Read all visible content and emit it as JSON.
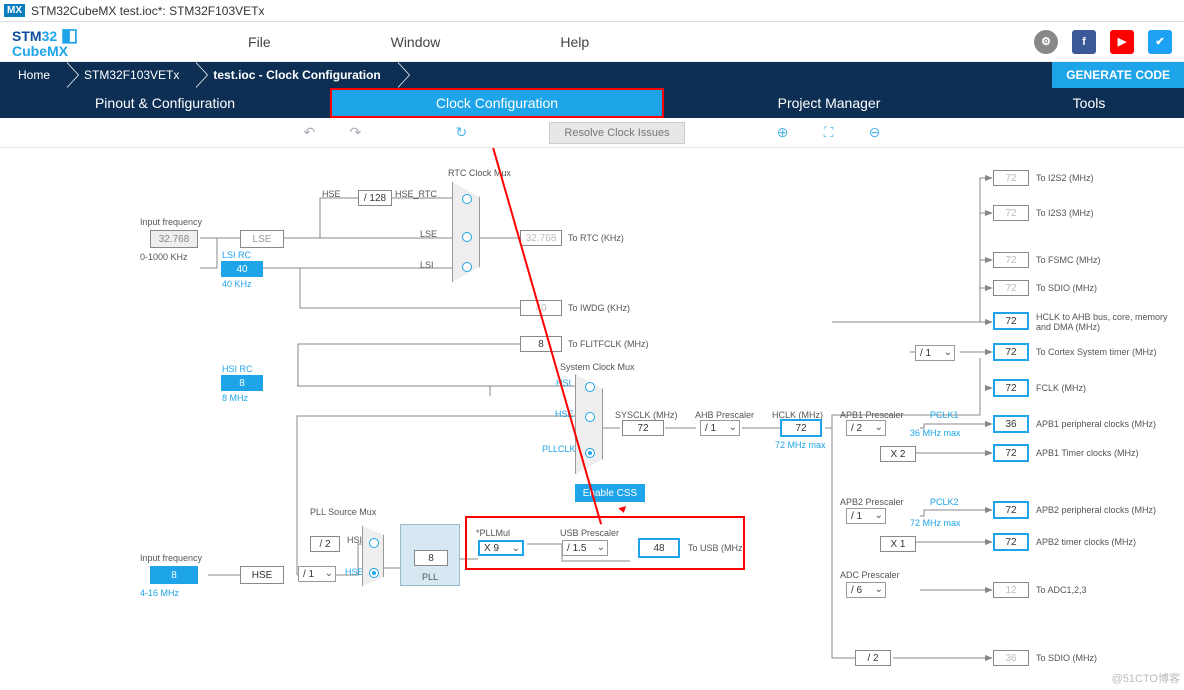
{
  "title_bar": {
    "app": "STM32CubeMX",
    "file": "test.ioc*:",
    "chip": "STM32F103VETx"
  },
  "menu": {
    "file": "File",
    "window": "Window",
    "help": "Help"
  },
  "breadcrumbs": {
    "home": "Home",
    "chip": "STM32F103VETx",
    "file": "test.ioc - Clock Configuration"
  },
  "generate": "GENERATE CODE",
  "tabs": {
    "pinout": "Pinout & Configuration",
    "clock": "Clock Configuration",
    "project": "Project Manager",
    "tools": "Tools"
  },
  "toolbar": {
    "resolve": "Resolve Clock Issues"
  },
  "clock": {
    "lse_freq": "32.768",
    "lse_range": "0-1000 KHz",
    "lse_label": "Input frequency",
    "lse": "LSE",
    "lsi_label": "LSI RC",
    "lsi": "40",
    "lsi_sub": "40 KHz",
    "hsi_label": "HSI RC",
    "hsi": "8",
    "hsi_sub": "8 MHz",
    "hse_freq": "8",
    "hse_range": "4-16 MHz",
    "hse_label": "Input frequency",
    "hse": "HSE",
    "hse_div128": "/ 128",
    "hse_rtc": "HSE_RTC",
    "hse_lbl": "HSE",
    "lse_lbl": "LSE",
    "lsi_lbl": "LSI",
    "rtc_mux": "RTC Clock Mux",
    "to_rtc": "To RTC (KHz)",
    "rtc_val": "32.768",
    "iwdg_val": "40",
    "to_iwdg": "To IWDG (KHz)",
    "flit_val": "8",
    "to_flit": "To FLITFCLK (MHz)",
    "sys_mux": "System Clock Mux",
    "hsi_lbl2": "HSI",
    "hse_lbl2": "HSE",
    "pllclk_lbl": "PLLCLK",
    "enable_css": "Enable CSS",
    "pll_src": "PLL Source Mux",
    "pll_div2": "/ 2",
    "pll_hsi": "HSI",
    "pll_hse": "HSE",
    "pll_div1": "/ 1",
    "pllmul_lbl": "*PLLMul",
    "pllmul": "X 9",
    "pll_val": "8",
    "pll_sub": "PLL",
    "usb_presc": "USB Prescaler",
    "usb_div": "/ 1.5",
    "usb_val": "48",
    "to_usb": "To USB (MHz)",
    "sysclk_lbl": "SYSCLK (MHz)",
    "sysclk": "72",
    "ahb_presc": "AHB Prescaler",
    "ahb_div": "/ 1",
    "hclk_lbl": "HCLK (MHz)",
    "hclk": "72",
    "hclk_max": "72 MHz max",
    "apb1_presc": "APB1 Prescaler",
    "apb1_div": "/ 2",
    "pclk1_lbl": "PCLK1",
    "pclk1_max": "36 MHz max",
    "apb1_x2": "X 2",
    "apb2_presc": "APB2 Prescaler",
    "apb2_div": "/ 1",
    "pclk2_lbl": "PCLK2",
    "pclk2_max": "72 MHz max",
    "apb2_x1": "X 1",
    "adc_presc": "ADC Prescaler",
    "adc_div": "/ 6",
    "to_adc": "To ADC1,2,3",
    "adc_val": "12",
    "sdio_div": "/ 2",
    "sdio_val": "36",
    "to_sdio2": "To SDIO (MHz)",
    "cortex_div": "/ 1",
    "out": {
      "i2s2": "72",
      "i2s2_lbl": "To I2S2 (MHz)",
      "i2s3": "72",
      "i2s3_lbl": "To I2S3 (MHz)",
      "fsmc": "72",
      "fsmc_lbl": "To FSMC (MHz)",
      "sdio": "72",
      "sdio_lbl": "To SDIO (MHz)",
      "ahb_bus": "72",
      "ahb_bus_lbl": "HCLK to AHB bus, core, memory and DMA (MHz)",
      "cortex": "72",
      "cortex_lbl": "To Cortex System timer (MHz)",
      "fclk": "72",
      "fclk_lbl": "FCLK (MHz)",
      "apb1_p": "36",
      "apb1_p_lbl": "APB1 peripheral clocks (MHz)",
      "apb1_t": "72",
      "apb1_t_lbl": "APB1 Timer clocks (MHz)",
      "apb2_p": "72",
      "apb2_p_lbl": "APB2 peripheral clocks (MHz)",
      "apb2_t": "72",
      "apb2_t_lbl": "APB2 timer clocks (MHz)"
    }
  },
  "watermark": "@51CTO博客"
}
